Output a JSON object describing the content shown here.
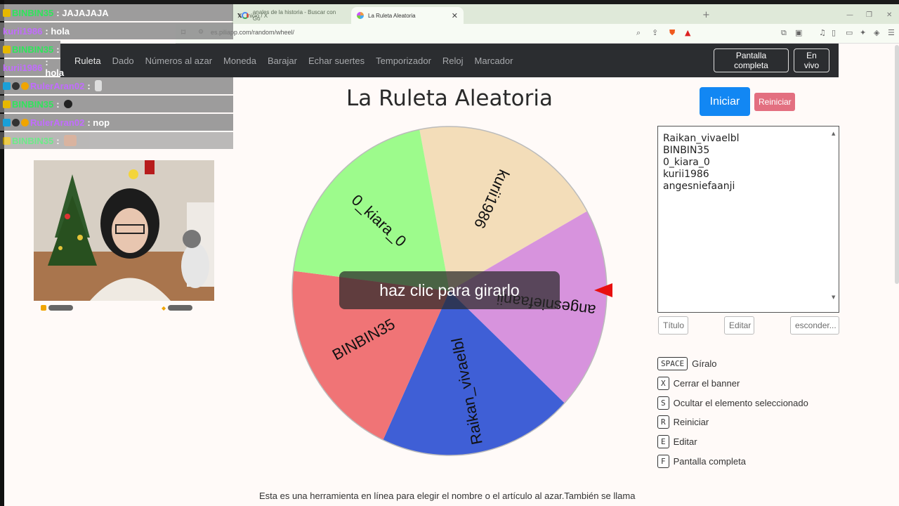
{
  "browser": {
    "tabs": [
      {
        "label": "Inicio / X"
      },
      {
        "label": "anales de la historia - Buscar con Go"
      },
      {
        "label": "La Ruleta Aleatoria"
      }
    ],
    "url": "es.piliapp.com/random/wheel/"
  },
  "nav": {
    "links": [
      "Ruleta",
      "Dado",
      "Números al azar",
      "Moneda",
      "Barajar",
      "Echar suertes",
      "Temporizador",
      "Reloj",
      "Marcador"
    ],
    "fullscreen_label": "Pantalla completa",
    "live_label": "En vivo"
  },
  "page": {
    "title": "La Ruleta Aleatoria",
    "start_label": "Iniciar",
    "reset_label": "Reiniciar",
    "banner": "haz clic para girarlo",
    "bottom_text": "Esta es una herramienta en línea para elegir el nombre o el artículo al azar.También se llama"
  },
  "wheel": {
    "segments": [
      {
        "label": "kurii1986",
        "color": "#f3ddb9"
      },
      {
        "label": "angesniefaanji",
        "color": "#d793dd"
      },
      {
        "label": "Raikan_vivaelbl",
        "color": "#3f5fd6"
      },
      {
        "label": "BINBIN35",
        "color": "#f07476"
      },
      {
        "label": "0_kiara_0",
        "color": "#9dfb8c"
      }
    ]
  },
  "names": [
    "Raikan_vivaelbl",
    "BINBIN35",
    "0_kiara_0",
    "kurii1986",
    "angesniefaanji"
  ],
  "names_buttons": {
    "title": "Título",
    "edit": "Editar",
    "hide": "esconder..."
  },
  "shortcuts": [
    {
      "key": "SPACE",
      "label": "Gíralo"
    },
    {
      "key": "X",
      "label": "Cerrar el banner"
    },
    {
      "key": "S",
      "label": "Ocultar el elemento seleccionado"
    },
    {
      "key": "R",
      "label": "Reiniciar"
    },
    {
      "key": "E",
      "label": "Editar"
    },
    {
      "key": "F",
      "label": "Pantalla completa"
    }
  ],
  "chat": [
    {
      "user": "BINBIN35",
      "msg": ": JAJAJAJA"
    },
    {
      "user": "kurii1986",
      "msg": ": hola"
    },
    {
      "user": "BINBIN35",
      "msg": ":"
    },
    {
      "user": "kurii1986",
      "msg": ": hola"
    },
    {
      "user": "RulerAran02",
      "msg": ":"
    },
    {
      "user": "BINBIN35",
      "msg": ":"
    },
    {
      "user": "RulerAran02",
      "msg": ": nop"
    },
    {
      "user": "BINBIN35",
      "msg": ":"
    }
  ],
  "colors": {
    "accent": "#1287f3",
    "reset": "#e36f80",
    "nav_bg": "#2b2d30",
    "pointer": "#e80f0f"
  }
}
